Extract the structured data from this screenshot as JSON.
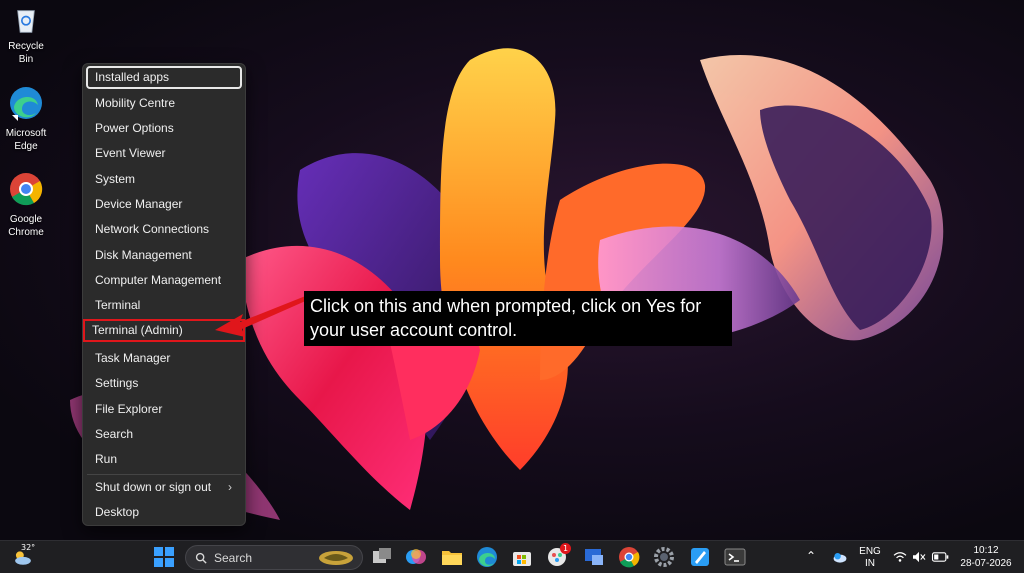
{
  "desktop": {
    "icons": [
      {
        "label": "Recycle Bin",
        "icon": "recycle-bin-icon"
      },
      {
        "label": "Microsoft Edge",
        "line1": "Microsoft",
        "line2": "Edge",
        "icon": "edge-icon"
      },
      {
        "label": "Google Chrome",
        "line1": "Google",
        "line2": "Chrome",
        "icon": "chrome-icon"
      }
    ]
  },
  "menu": {
    "items": [
      {
        "label": "Installed apps"
      },
      {
        "label": "Mobility Centre"
      },
      {
        "label": "Power Options"
      },
      {
        "label": "Event Viewer"
      },
      {
        "label": "System"
      },
      {
        "label": "Device Manager"
      },
      {
        "label": "Network Connections"
      },
      {
        "label": "Disk Management"
      },
      {
        "label": "Computer Management"
      },
      {
        "label": "Terminal"
      },
      {
        "label": "Terminal (Admin)"
      },
      {
        "label": "Task Manager"
      },
      {
        "label": "Settings"
      },
      {
        "label": "File Explorer"
      },
      {
        "label": "Search"
      },
      {
        "label": "Run"
      },
      {
        "label": "Shut down or sign out"
      },
      {
        "label": "Desktop"
      }
    ],
    "highlight_color": "#e0161b"
  },
  "callout": {
    "text": "Click on this and when prompted, click on Yes for your user account control."
  },
  "taskbar": {
    "weather_temp": "32°",
    "search_placeholder": "Search",
    "apps": [
      "start-icon",
      "search-icon",
      "task-view-icon",
      "copilot-icon",
      "file-explorer-icon",
      "edge-icon",
      "microsoft-store-icon",
      "whatsapp-icon",
      "remote-desktop-icon",
      "chrome-icon",
      "settings-icon",
      "paint-icon",
      "terminal-icon"
    ],
    "notification_badge": "1",
    "language": "ENG",
    "region": "IN",
    "time": "10:12",
    "date": "28-07-2026"
  }
}
